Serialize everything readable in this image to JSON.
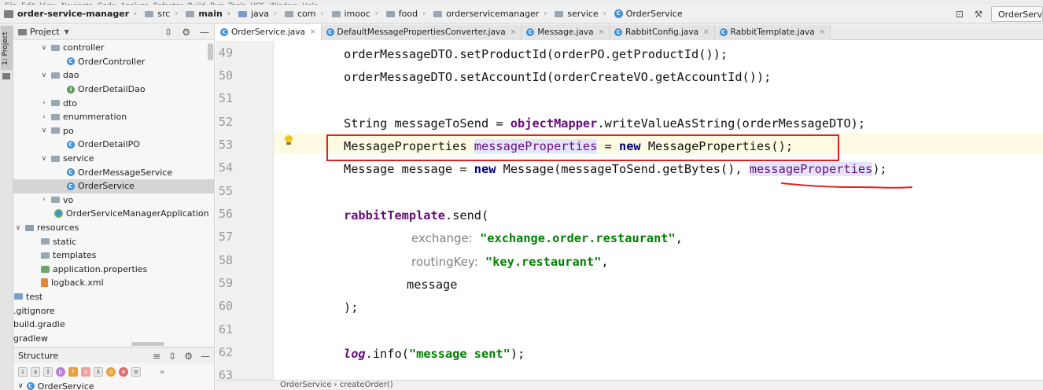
{
  "menu": [
    "File",
    "Edit",
    "View",
    "Navigate",
    "Code",
    "Analyze",
    "Refactor",
    "Build",
    "Run",
    "Tools",
    "VCS",
    "Window",
    "Help"
  ],
  "breadcrumb": [
    "order-service-manager",
    "src",
    "main",
    "java",
    "com",
    "imooc",
    "food",
    "orderservicemanager",
    "service",
    "OrderService"
  ],
  "run_config": "OrderServ",
  "project_panel": {
    "title": "Project",
    "tree": [
      {
        "label": "controller",
        "type": "folder",
        "expanded": true
      },
      {
        "label": "OrderController",
        "type": "class"
      },
      {
        "label": "dao",
        "type": "folder",
        "expanded": true
      },
      {
        "label": "OrderDetailDao",
        "type": "interface"
      },
      {
        "label": "dto",
        "type": "folder",
        "expanded": false
      },
      {
        "label": "enummeration",
        "type": "folder",
        "expanded": false
      },
      {
        "label": "po",
        "type": "folder",
        "expanded": true
      },
      {
        "label": "OrderDetailPO",
        "type": "class"
      },
      {
        "label": "service",
        "type": "folder",
        "expanded": true
      },
      {
        "label": "OrderMessageService",
        "type": "class"
      },
      {
        "label": "OrderService",
        "type": "class",
        "selected": true
      },
      {
        "label": "vo",
        "type": "folder",
        "expanded": false
      },
      {
        "label": "OrderServiceManagerApplication",
        "type": "app"
      },
      {
        "label": "resources",
        "type": "resources",
        "expanded": true
      },
      {
        "label": "static",
        "type": "folder"
      },
      {
        "label": "templates",
        "type": "folder"
      },
      {
        "label": "application.properties",
        "type": "properties"
      },
      {
        "label": "logback.xml",
        "type": "xml"
      },
      {
        "label": "test",
        "type": "test"
      },
      {
        "label": ".gitignore",
        "type": "file"
      },
      {
        "label": "build.gradle",
        "type": "file"
      },
      {
        "label": "gradlew",
        "type": "file"
      }
    ]
  },
  "structure_panel": {
    "title": "Structure",
    "root": "OrderService"
  },
  "tabs": [
    {
      "label": "OrderService.java",
      "active": true
    },
    {
      "label": "DefaultMessagePropertiesConverter.java"
    },
    {
      "label": "Message.java"
    },
    {
      "label": "RabbitConfig.java"
    },
    {
      "label": "RabbitTemplate.java"
    }
  ],
  "line_numbers": [
    "49",
    "50",
    "51",
    "52",
    "53",
    "54",
    "55",
    "56",
    "57",
    "58",
    "59",
    "60",
    "61",
    "62",
    "63"
  ],
  "code": {
    "l49": "orderMessageDTO.setProductId(orderPO.getProductId());",
    "l50": "orderMessageDTO.setAccountId(orderCreateVO.getAccountId());",
    "l52_a": "String messageToSend = ",
    "l52_b": "objectMapper",
    "l52_c": ".writeValueAsString(orderMessageDTO);",
    "l53_a": "MessageProperties ",
    "l53_b": "messageProperties",
    "l53_c": " = ",
    "l53_d": "new",
    "l53_e": " MessageProperties();",
    "l54_a": "Message message = ",
    "l54_b": "new",
    "l54_c": " Message(messageToSend.getBytes(), ",
    "l54_d": "messageProperties",
    "l54_e": ");",
    "l56_a": "rabbitTemplate",
    "l56_b": ".send(",
    "l57_hint": "exchange:",
    "l57_str": "\"exchange.order.restaurant\"",
    "l57_end": ",",
    "l58_hint": "routingKey:",
    "l58_str": "\"key.restaurant\"",
    "l58_end": ",",
    "l59": "message",
    "l60": ");",
    "l62_a": "log",
    "l62_b": ".info(",
    "l62_str": "\"message sent\"",
    "l62_c": ");"
  },
  "status_breadcrumb": "OrderService  ›  createOrder()",
  "colors": {
    "keyword": "#000080",
    "field": "#660e7a",
    "string": "#008000",
    "annotation_red": "#e02020"
  }
}
